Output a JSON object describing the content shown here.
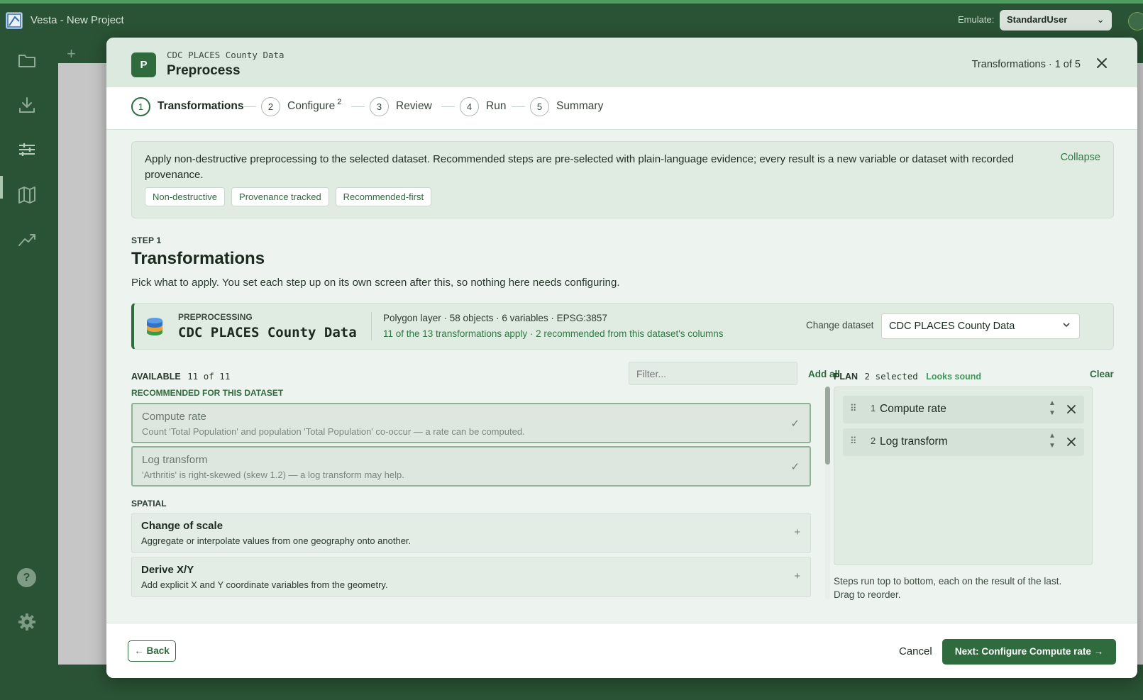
{
  "app": {
    "title": "Vesta - New Project",
    "emulate_label": "Emulate:",
    "emulate_value": "StandardUser"
  },
  "rail": {
    "icons": [
      "folder-icon",
      "download-icon",
      "sliders-icon",
      "map-icon",
      "trend-icon",
      "help-icon",
      "settings-icon"
    ],
    "help_glyph": "?"
  },
  "modal": {
    "badge": "P",
    "subtitle": "CDC PLACES County Data",
    "title": "Preprocess",
    "counter": "Transformations · 1 of 5",
    "steps": [
      {
        "num": "1",
        "label": "Transformations",
        "badge": ""
      },
      {
        "num": "2",
        "label": "Configure",
        "badge": "2"
      },
      {
        "num": "3",
        "label": "Review",
        "badge": ""
      },
      {
        "num": "4",
        "label": "Run",
        "badge": ""
      },
      {
        "num": "5",
        "label": "Summary",
        "badge": ""
      }
    ],
    "intro": {
      "text": "Apply non-destructive preprocessing to the selected dataset. Recommended steps are pre-selected with plain-language evidence; every result is a new variable or dataset with recorded provenance.",
      "collapse": "Collapse",
      "chips": [
        "Non-destructive",
        "Provenance tracked",
        "Recommended-first"
      ]
    },
    "step_kicker": "STEP 1",
    "step_heading": "Transformations",
    "step_desc": "Pick what to apply. You set each step up on its own screen after this, so nothing here needs configuring.",
    "dataset": {
      "kicker": "PREPROCESSING",
      "name": "CDC PLACES County Data",
      "meta1": "Polygon layer · 58 objects · 6 variables · EPSG:3857",
      "meta2": "11 of the 13 transformations apply · 2 recommended from this dataset's columns",
      "change_label": "Change dataset",
      "selected": "CDC PLACES County Data"
    },
    "available": {
      "label": "AVAILABLE",
      "count": "11 of 11",
      "filter_placeholder": "Filter...",
      "add_all": "Add all",
      "groups": {
        "recommended": "RECOMMENDED FOR THIS DATASET",
        "spatial": "SPATIAL"
      },
      "recommended": [
        {
          "title": "Compute rate",
          "desc": "Count 'Total Population' and population 'Total Population' co-occur — a rate can be computed.",
          "mark": "✓"
        },
        {
          "title": "Log transform",
          "desc": "'Arthritis' is right-skewed (skew 1.2) — a log transform may help.",
          "mark": "✓"
        }
      ],
      "spatial": [
        {
          "title": "Change of scale",
          "desc": "Aggregate or interpolate values from one geography onto another.",
          "mark": "+"
        },
        {
          "title": "Derive X/Y",
          "desc": "Add explicit X and Y coordinate variables from the geometry.",
          "mark": "+"
        }
      ]
    },
    "plan": {
      "label": "PLAN",
      "count": "2 selected",
      "status": "Looks sound",
      "clear": "Clear",
      "items": [
        {
          "num": "1",
          "label": "Compute rate"
        },
        {
          "num": "2",
          "label": "Log transform"
        }
      ],
      "note": "Steps run top to bottom, each on the result of the last. Drag to reorder."
    },
    "footer": {
      "back": "← Back",
      "cancel": "Cancel",
      "next": "Next: Configure Compute rate →"
    }
  },
  "colors": {
    "brand_green": "#2f6b3d",
    "chrome": "#2a5234",
    "accent_green": "#3f9a5a"
  }
}
